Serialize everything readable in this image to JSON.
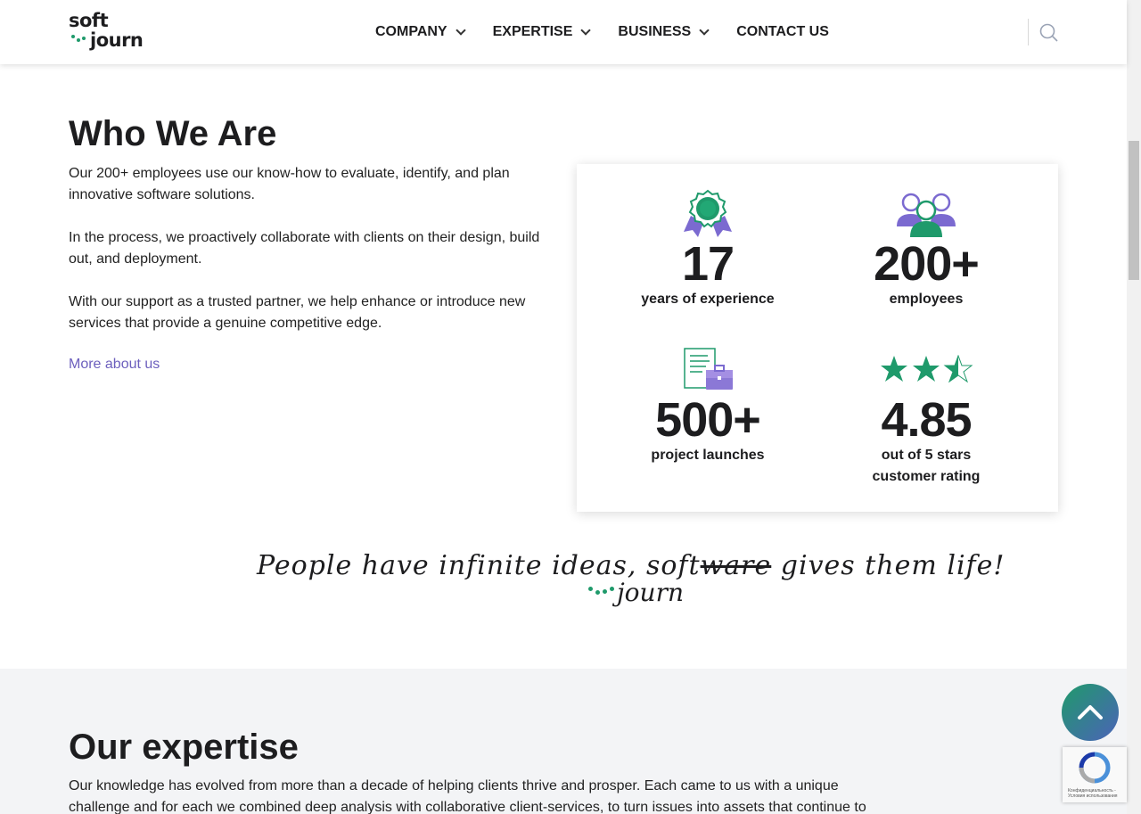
{
  "header": {
    "logo_top": "soft",
    "logo_bottom": "journ",
    "nav": [
      {
        "label": "COMPANY"
      },
      {
        "label": "EXPERTISE"
      },
      {
        "label": "BUSINESS"
      },
      {
        "label": "CONTACT US"
      }
    ]
  },
  "who": {
    "title": "Who We Are",
    "p1": "Our 200+ employees use our know-how to evaluate, identify, and plan innovative software solutions.",
    "p2": "In the process, we proactively collaborate with clients on their design, build out, and deployment.",
    "p3": "With our support as a trusted partner, we help enhance or introduce new services that provide a genuine competitive edge.",
    "more_link": "More about us"
  },
  "stats": [
    {
      "number": "17",
      "label": "years of experience",
      "icon": "award-ribbon-icon"
    },
    {
      "number": "200+",
      "label": "employees",
      "icon": "people-group-icon"
    },
    {
      "number": "500+",
      "label": "project launches",
      "icon": "document-briefcase-icon"
    },
    {
      "number": "4.85",
      "label": "out of 5 stars",
      "label2": "customer rating",
      "icon": "stars-rating-icon",
      "rating": 4.85
    }
  ],
  "quote": {
    "before": "People have infinite ideas, soft",
    "struck": "ware",
    "after": " gives them life!",
    "sub": "journ"
  },
  "expertise": {
    "title": "Our expertise",
    "text": "Our knowledge has evolved from more than a decade of helping clients thrive and prosper. Each came to us with a unique challenge and for each we combined deep analysis with collaborative client-services, to turn issues into assets that continue to"
  },
  "recaptcha": {
    "text": "Конфиденциальность - Условия использования"
  },
  "colors": {
    "accent_green": "#1f9a6b",
    "accent_purple": "#6c5fbd",
    "section_bg": "#f3f4f6"
  }
}
